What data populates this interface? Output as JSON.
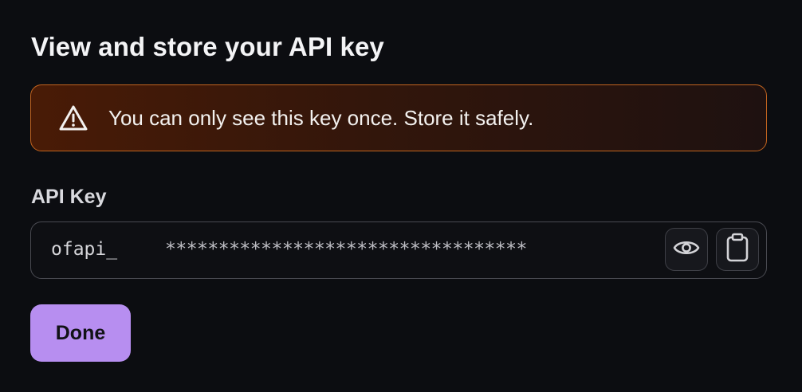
{
  "dialog": {
    "title": "View and store your API key"
  },
  "warning": {
    "icon": "warning-triangle-icon",
    "text": "You can only see this key once. Store it safely.",
    "border_color": "#c2641f",
    "background_color": "#491b06"
  },
  "api_key": {
    "label": "API Key",
    "prefix": "ofapi_",
    "masked_value": "**********************************",
    "reveal_icon": "eye-icon",
    "copy_icon": "clipboard-icon"
  },
  "actions": {
    "done_label": "Done",
    "done_color": "#b78ef0"
  }
}
